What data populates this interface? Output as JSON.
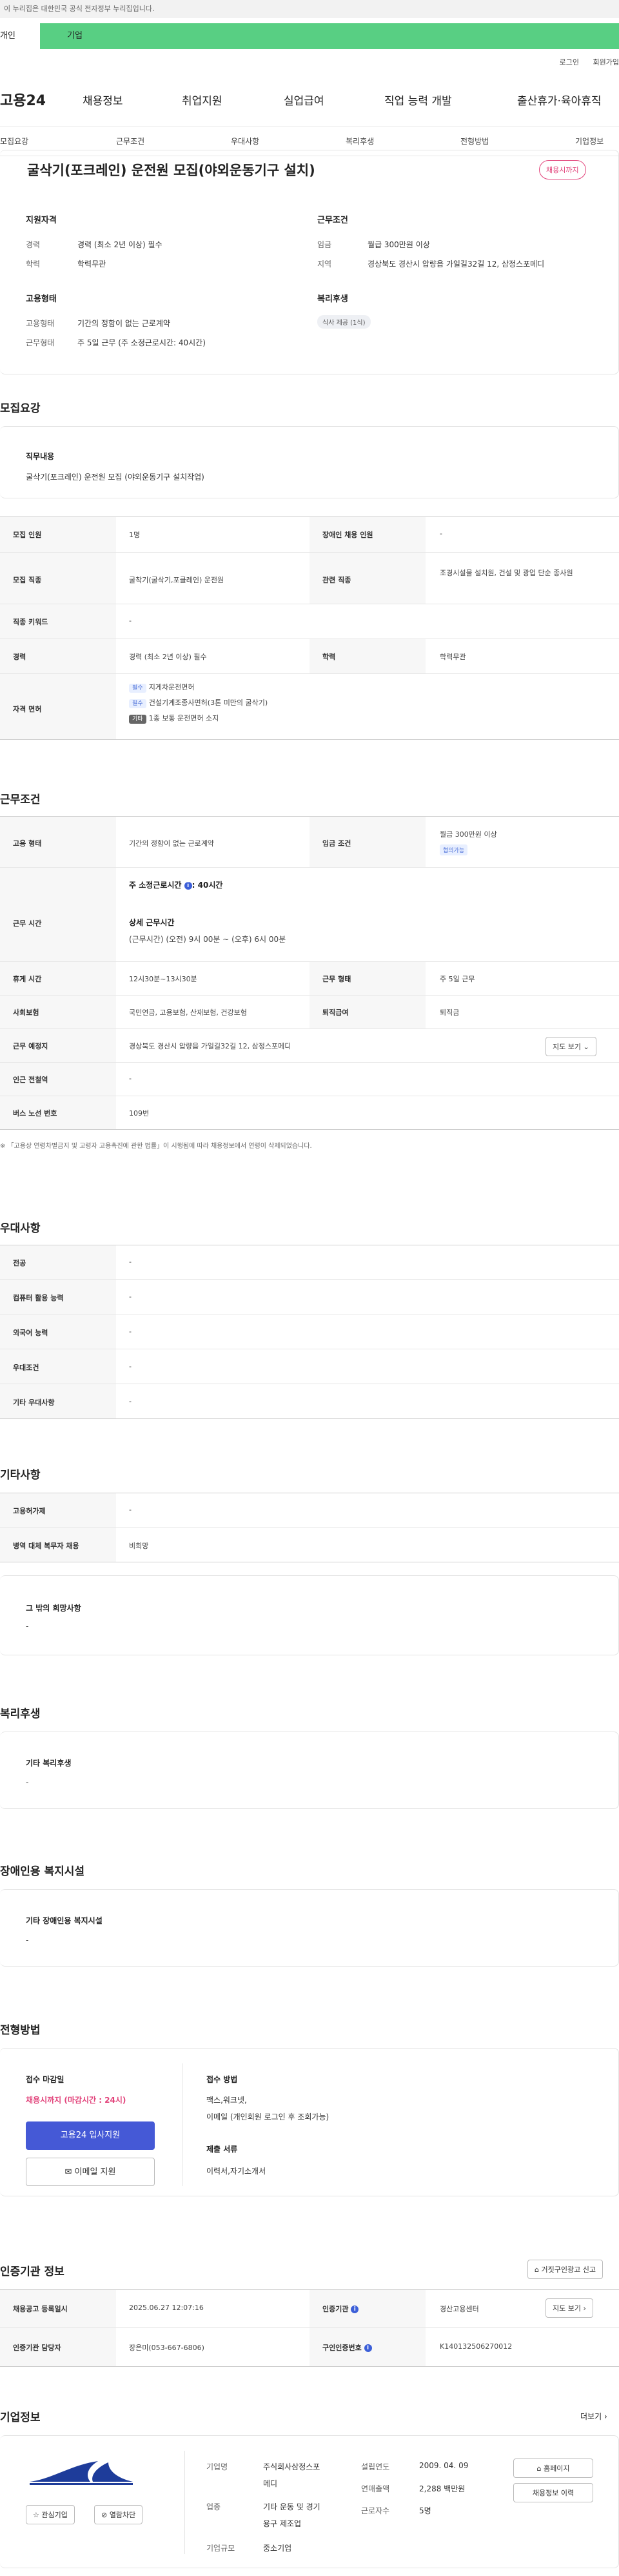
{
  "gov_banner": "이 누리집은 대한민국 공식 전자정부 누리집입니다.",
  "top_tabs": [
    "개인",
    "기업"
  ],
  "top_links": [
    "로그인",
    "회원가입"
  ],
  "logo": "고용24",
  "gnb": [
    "채용정보",
    "취업지원",
    "실업급여",
    "직업 능력 개발",
    "출산휴가·육아휴직"
  ],
  "lnb": [
    "모집요강",
    "근무조건",
    "우대사항",
    "복리후생",
    "전형방법",
    "기업정보"
  ],
  "summary": {
    "title": "굴삭기(포크레인) 운전원 모집(야외운동기구 설치)",
    "deadline_badge": "채용시까지",
    "qual_title": "지원자격",
    "career_k": "경력",
    "career_v": "경력 (최소 2년 이상) 필수",
    "edu_k": "학력",
    "edu_v": "학력무관",
    "emp_title": "고용형태",
    "emp_k": "고용형태",
    "emp_v": "기간의 정함이 없는 근로계약",
    "work_k": "근무형태",
    "work_v": "주 5일 근무 (주 소정근로시간: 40시간)",
    "cond_title": "근무조건",
    "wage_k": "임금",
    "wage_v": "월급 300만원 이상",
    "region_k": "지역",
    "region_v": "경상북도 경산시 압량읍 가일길32길 12, 삼정스포메디",
    "welfare_title": "복리후생",
    "welfare_chip": "식사 제공 (1식)"
  },
  "recruit": {
    "heading": "모집요강",
    "duty_title": "직무내용",
    "duty_text": "굴삭기(포크레인) 운전원 모집 (야외운동기구 설치작업)",
    "persons_k": "모집 인원",
    "persons_v": "1명",
    "disabled_k": "장애인 채용 인원",
    "disabled_v": "-",
    "job_k": "모집 직종",
    "job_v": "굴착기(굴삭기,포클레인) 운전원",
    "rel_k": "관련 직종",
    "rel_v": "조경시설물 설치원, 건설 및 광업 단순 종사원",
    "kw_k": "직종 키워드",
    "kw_v": "-",
    "exp_k": "경력",
    "exp_v": "경력 (최소 2년 이상) 필수",
    "edu_k": "학력",
    "edu_v": "학력무관",
    "lic_k": "자격 면허",
    "licenses": [
      {
        "tag": "필수",
        "text": "지게차운전면허"
      },
      {
        "tag": "필수",
        "text": "건설기계조종사면허(3톤 미만의 굴삭기)"
      },
      {
        "tag": "기타",
        "text": "1종 보통 운전면허 소지"
      }
    ]
  },
  "work": {
    "heading": "근무조건",
    "emp_k": "고용 형태",
    "emp_v": "기간의 정함이 없는 근로계약",
    "wage_k": "임금 조건",
    "wage_v": "월급 300만원 이상",
    "wage_tag": "협의가능",
    "time_k": "근무 시간",
    "weekly": "주 소정근로시간",
    "weekly_v": ": 40시간",
    "detail_title": "상세 근무시간",
    "detail_v": "(근무시간) (오전) 9시 00분 ~ (오후) 6시 00분",
    "break_k": "휴게 시간",
    "break_v": "12시30분~13시30분",
    "form_k": "근무 형태",
    "form_v": "주 5일 근무",
    "ins_k": "사회보험",
    "ins_v": "국민연금, 고용보험, 산재보험, 건강보험",
    "ret_k": "퇴직급여",
    "ret_v": "퇴직금",
    "place_k": "근무 예정지",
    "place_v": "경상북도 경산시 압량읍 가일길32길 12, 삼정스포메디",
    "map_btn": "지도 보기",
    "station_k": "인근 전철역",
    "station_v": "-",
    "bus_k": "버스 노선 번호",
    "bus_v": "109번",
    "note": "※ 「고용상 연령차별금지 및 고령자 고용촉진에 관한 법률」이 시행됨에 따라 채용정보에서 연령이 삭제되었습니다."
  },
  "pref": {
    "heading": "우대사항",
    "rows": [
      {
        "k": "전공",
        "v": "-"
      },
      {
        "k": "컴퓨터 활용 능력",
        "v": "-"
      },
      {
        "k": "외국어 능력",
        "v": "-"
      },
      {
        "k": "우대조건",
        "v": "-"
      },
      {
        "k": "기타 우대사항",
        "v": "-"
      }
    ]
  },
  "etc": {
    "heading": "기타사항",
    "rows": [
      {
        "k": "고용허가제",
        "v": "-"
      },
      {
        "k": "병역 대체 복무자 채용",
        "v": "비희망"
      }
    ],
    "hope_title": "그 밖의 희망사항",
    "hope_v": "-"
  },
  "benefit": {
    "heading": "복리후생",
    "box_title": "기타 복리후생",
    "box_v": "-"
  },
  "disab": {
    "heading": "장애인용 복지시설",
    "box_title": "기타 장애인용 복지시설",
    "box_v": "-"
  },
  "process": {
    "heading": "전형방법",
    "deadline_title": "접수 마감일",
    "deadline_v": "채용시까지 (마감시간 : 24시)",
    "apply_btn": "고용24 입사지원",
    "email_btn": "이메일 지원",
    "method_title": "접수 방법",
    "method_v1": "팩스,워크넷,",
    "method_v2": "이메일 (개인회원 로그인 후 조회가능)",
    "docs_title": "제출 서류",
    "docs_v": "이력서,자기소개서"
  },
  "cert": {
    "heading": "인증기관 정보",
    "report_btn": "거짓구인광고 신고",
    "reg_k": "채용공고 등록일시",
    "reg_v": "2025.06.27 12:07:16",
    "agency_k": "인증기관",
    "agency_v": "경산고용센터",
    "map_btn": "지도 보기",
    "mgr_k": "인증기관 담당자",
    "mgr_v": "장은미(053-667-6806)",
    "no_k": "구인인증번호",
    "no_v": "K140132506270012"
  },
  "company": {
    "heading": "기업정보",
    "more": "더보기",
    "interest_btn": "관심기업",
    "block_btn": "열람차단",
    "name_k": "기업명",
    "name_v1": "주식회사삼정스포",
    "name_v2": "메디",
    "ind_k": "업종",
    "ind_v1": "기타 운동 및 경기",
    "ind_v2": "용구 제조업",
    "size_k": "기업규모",
    "size_v": "중소기업",
    "est_k": "설립연도",
    "est_v": "2009. 04. 09",
    "sales_k": "연매출액",
    "sales_v": "2,288 백만원",
    "staff_k": "근로자수",
    "staff_v": "5명",
    "home_btn": "홈페이지",
    "jobs_btn": "채용정보 이력"
  },
  "colors": {
    "accent": "#58cf83",
    "brand_blue": "#4559d6",
    "badge_red": "#e2447b"
  }
}
